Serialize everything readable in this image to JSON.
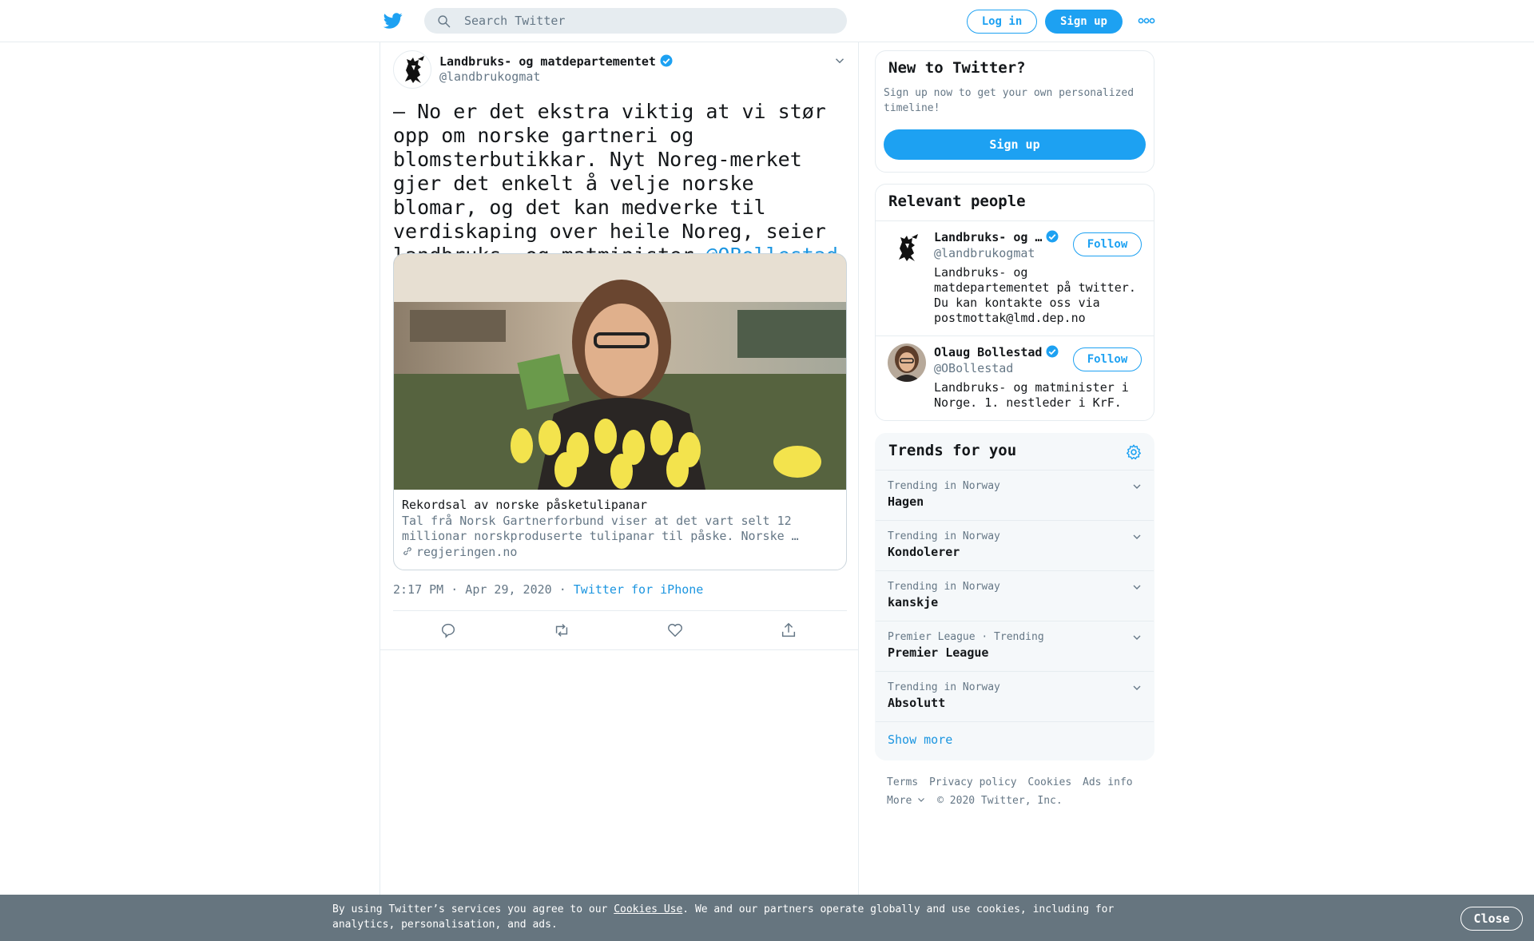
{
  "header": {
    "search_placeholder": "Search Twitter",
    "login_label": "Log in",
    "signup_label": "Sign up"
  },
  "tweet": {
    "author_name": "Landbruks- og matdepartementet",
    "author_handle": "@landbrukogmat",
    "text": "– No er det ekstra viktig at vi stør opp om norske gartneri og blomsterbutikkar. Nyt Noreg-merket gjer det enkelt å velje norske blomar, og det kan medverke til verdiskaping over heile Noreg, seier landbruks- og matminister ",
    "mention": "@OBollestad",
    "card": {
      "title": "Rekordsal av norske påsketulipanar",
      "description": "Tal frå Norsk Gartnerforbund viser at det vart selt 12 millionar norskproduserte tulipanar til påske. Norske …",
      "domain": "regjeringen.no"
    },
    "timestamp": "2:17 PM · Apr 29, 2020",
    "separator": "·",
    "source": "Twitter for iPhone"
  },
  "sidebar": {
    "new_to_twitter": {
      "title": "New to Twitter?",
      "description": "Sign up now to get your own personalized timeline!",
      "signup_label": "Sign up"
    },
    "relevant_people": {
      "title": "Relevant people",
      "people": [
        {
          "name": "Landbruks- og …",
          "handle": "@landbrukogmat",
          "bio": "Landbruks- og matdepartementet på twitter. Du kan kontakte oss via postmottak@lmd.dep.no",
          "follow_label": "Follow"
        },
        {
          "name": "Olaug Bollestad",
          "handle": "@OBollestad",
          "bio": "Landbruks- og matminister i Norge. 1. nestleder i KrF.",
          "follow_label": "Follow"
        }
      ]
    },
    "trends": {
      "title": "Trends for you",
      "items": [
        {
          "meta": "Trending in Norway",
          "name": "Hagen"
        },
        {
          "meta": "Trending in Norway",
          "name": "Kondolerer"
        },
        {
          "meta": "Trending in Norway",
          "name": "kanskje"
        },
        {
          "meta": "Premier League · Trending",
          "name": "Premier League"
        },
        {
          "meta": "Trending in Norway",
          "name": "Absolutt"
        }
      ],
      "show_more": "Show more"
    },
    "footer": {
      "links": [
        "Terms",
        "Privacy policy",
        "Cookies",
        "Ads info"
      ],
      "more_label": "More",
      "copyright": "© 2020 Twitter, Inc."
    }
  },
  "cookie_banner": {
    "text_before": "By using Twitter’s services you agree to our ",
    "link_label": "Cookies Use",
    "text_after": ". We and our partners operate globally and use cookies, including for analytics, personalisation, and ads.",
    "close_label": "Close"
  },
  "colors": {
    "brand_blue": "#1da1f2",
    "link_blue": "#1b95e0",
    "secondary_text": "#657786",
    "cookie_bar": "#66757f"
  },
  "icons": [
    "twitter-bird-icon",
    "search-icon",
    "more-icon",
    "verified-badge-icon",
    "chevron-down-icon",
    "link-icon",
    "reply-icon",
    "retweet-icon",
    "like-icon",
    "share-icon",
    "settings-gear-icon"
  ]
}
